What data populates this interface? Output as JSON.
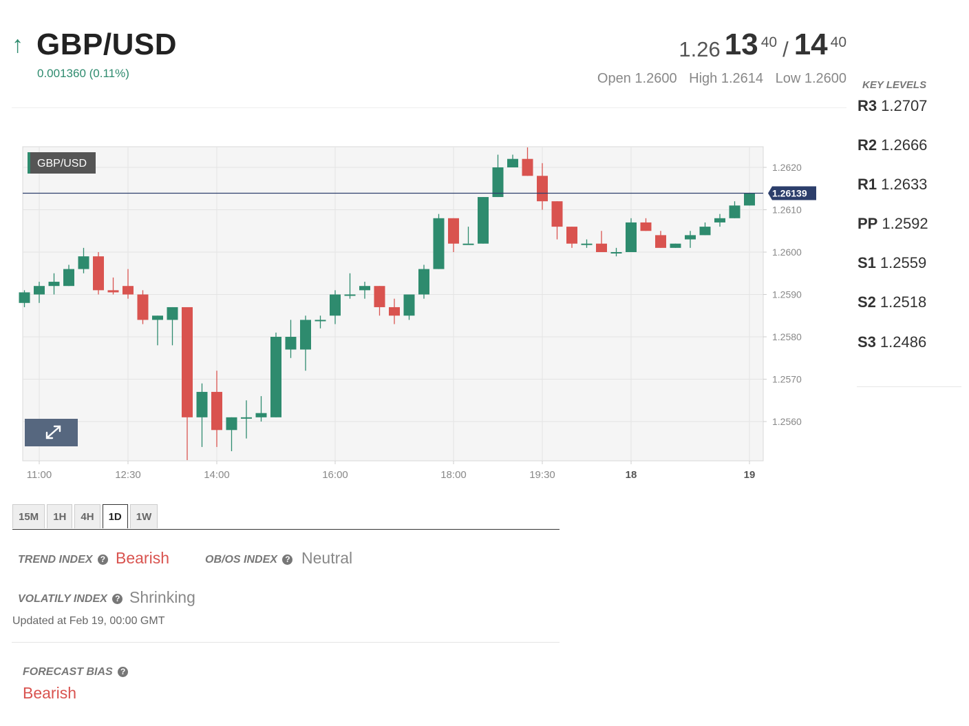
{
  "header": {
    "pair": "GBP/USD",
    "direction_icon": "arrow-up-icon",
    "change": "0.001360 (0.11%)",
    "bid_base": "1.26",
    "bid_big": "13",
    "bid_pip": "40",
    "separator": "/",
    "ask_big": "14",
    "ask_pip": "40",
    "open": "Open 1.2600",
    "high": "High 1.2614",
    "low": "Low 1.2600"
  },
  "key_levels": {
    "title": "KEY LEVELS",
    "items": [
      {
        "label": "R3",
        "value": "1.2707"
      },
      {
        "label": "R2",
        "value": "1.2666"
      },
      {
        "label": "R1",
        "value": "1.2633"
      },
      {
        "label": "PP",
        "value": "1.2592"
      },
      {
        "label": "S1",
        "value": "1.2559"
      },
      {
        "label": "S2",
        "value": "1.2518"
      },
      {
        "label": "S3",
        "value": "1.2486"
      }
    ]
  },
  "chart_data": {
    "type": "candlestick",
    "series_label": "GBP/USD",
    "last_price": 1.26139,
    "last_price_label": "1.26139",
    "ylim": [
      1.2549,
      1.2624
    ],
    "y_ticks": [
      {
        "v": 1.262,
        "label": "1.2620"
      },
      {
        "v": 1.261,
        "label": "1.2610"
      },
      {
        "v": 1.26,
        "label": "1.2600"
      },
      {
        "v": 1.259,
        "label": "1.2590"
      },
      {
        "v": 1.258,
        "label": "1.2580"
      },
      {
        "v": 1.257,
        "label": "1.2570"
      },
      {
        "v": 1.256,
        "label": "1.2560"
      }
    ],
    "x_ticks": [
      {
        "i": 1,
        "label": "11:00",
        "bold": false
      },
      {
        "i": 7,
        "label": "12:30",
        "bold": false
      },
      {
        "i": 13,
        "label": "14:00",
        "bold": false
      },
      {
        "i": 21,
        "label": "16:00",
        "bold": false
      },
      {
        "i": 29,
        "label": "18:00",
        "bold": false
      },
      {
        "i": 35,
        "label": "19:30",
        "bold": false
      },
      {
        "i": 41,
        "label": "18",
        "bold": true
      },
      {
        "i": 49,
        "label": "19",
        "bold": true
      }
    ],
    "candles": [
      [
        1.2588,
        1.2591,
        1.2587,
        1.25905
      ],
      [
        1.259,
        1.2593,
        1.2588,
        1.2592
      ],
      [
        1.2592,
        1.2595,
        1.259,
        1.2593
      ],
      [
        1.2592,
        1.2597,
        1.2592,
        1.2596
      ],
      [
        1.2596,
        1.2601,
        1.2595,
        1.2599
      ],
      [
        1.2599,
        1.26,
        1.259,
        1.2591
      ],
      [
        1.2591,
        1.2594,
        1.259,
        1.25905
      ],
      [
        1.2592,
        1.2596,
        1.2589,
        1.259
      ],
      [
        1.259,
        1.2591,
        1.2583,
        1.2584
      ],
      [
        1.2584,
        1.2585,
        1.2578,
        1.2585
      ],
      [
        1.2584,
        1.2587,
        1.2578,
        1.2587
      ],
      [
        1.2587,
        1.2587,
        1.255,
        1.2561
      ],
      [
        1.2561,
        1.2569,
        1.2554,
        1.2567
      ],
      [
        1.2567,
        1.2572,
        1.2554,
        1.2558
      ],
      [
        1.2558,
        1.2561,
        1.2553,
        1.2561
      ],
      [
        1.2561,
        1.2565,
        1.2556,
        1.2561
      ],
      [
        1.2561,
        1.2566,
        1.256,
        1.2562
      ],
      [
        1.2561,
        1.2581,
        1.2561,
        1.258
      ],
      [
        1.2577,
        1.2584,
        1.2575,
        1.258
      ],
      [
        1.2577,
        1.2585,
        1.2572,
        1.2584
      ],
      [
        1.2584,
        1.2585,
        1.2582,
        1.2584
      ],
      [
        1.2585,
        1.2591,
        1.2583,
        1.259
      ],
      [
        1.259,
        1.2595,
        1.2589,
        1.259
      ],
      [
        1.2591,
        1.2593,
        1.2589,
        1.2592
      ],
      [
        1.2592,
        1.2592,
        1.2585,
        1.2587
      ],
      [
        1.2587,
        1.2589,
        1.2583,
        1.2585
      ],
      [
        1.2585,
        1.259,
        1.2584,
        1.259
      ],
      [
        1.259,
        1.2597,
        1.2589,
        1.2596
      ],
      [
        1.2596,
        1.2609,
        1.2596,
        1.2608
      ],
      [
        1.2608,
        1.2608,
        1.26,
        1.2602
      ],
      [
        1.2602,
        1.2606,
        1.2602,
        1.2602
      ],
      [
        1.2602,
        1.2613,
        1.2602,
        1.2613
      ],
      [
        1.2613,
        1.2623,
        1.2613,
        1.262
      ],
      [
        1.262,
        1.2623,
        1.262,
        1.2622
      ],
      [
        1.2622,
        1.2625,
        1.2618,
        1.2618
      ],
      [
        1.2618,
        1.2621,
        1.261,
        1.2612
      ],
      [
        1.2612,
        1.2612,
        1.2603,
        1.2606
      ],
      [
        1.2606,
        1.2606,
        1.2601,
        1.2602
      ],
      [
        1.2602,
        1.2603,
        1.2601,
        1.2602
      ],
      [
        1.2602,
        1.2605,
        1.26,
        1.26
      ],
      [
        1.26,
        1.2601,
        1.2599,
        1.26
      ],
      [
        1.26,
        1.2608,
        1.26,
        1.2607
      ],
      [
        1.2607,
        1.2608,
        1.2605,
        1.2605
      ],
      [
        1.2604,
        1.2605,
        1.2601,
        1.2601
      ],
      [
        1.2601,
        1.2602,
        1.2601,
        1.2602
      ],
      [
        1.2603,
        1.2605,
        1.2601,
        1.2604
      ],
      [
        1.2604,
        1.2607,
        1.2604,
        1.2606
      ],
      [
        1.2607,
        1.2609,
        1.2606,
        1.2608
      ],
      [
        1.2608,
        1.2612,
        1.2608,
        1.2611
      ],
      [
        1.2611,
        1.2614,
        1.2611,
        1.26139
      ]
    ]
  },
  "timeframes": {
    "items": [
      "15M",
      "1H",
      "4H",
      "1D",
      "1W"
    ],
    "active": "1D"
  },
  "indices": {
    "trend_label": "TREND INDEX",
    "trend_value": "Bearish",
    "obos_label": "OB/OS INDEX",
    "obos_value": "Neutral",
    "vol_label": "VOLATILY INDEX",
    "vol_value": "Shrinking",
    "help_icon": "question-circle-icon",
    "updated": "Updated at Feb 19, 00:00 GMT"
  },
  "forecast": {
    "label": "FORECAST BIAS",
    "value": "Bearish"
  },
  "colors": {
    "up": "#2e8b6e",
    "down": "#d9534f",
    "price_line": "#2c3e6b",
    "plot_bg": "#f5f5f5",
    "expand_button": "#56677f"
  }
}
